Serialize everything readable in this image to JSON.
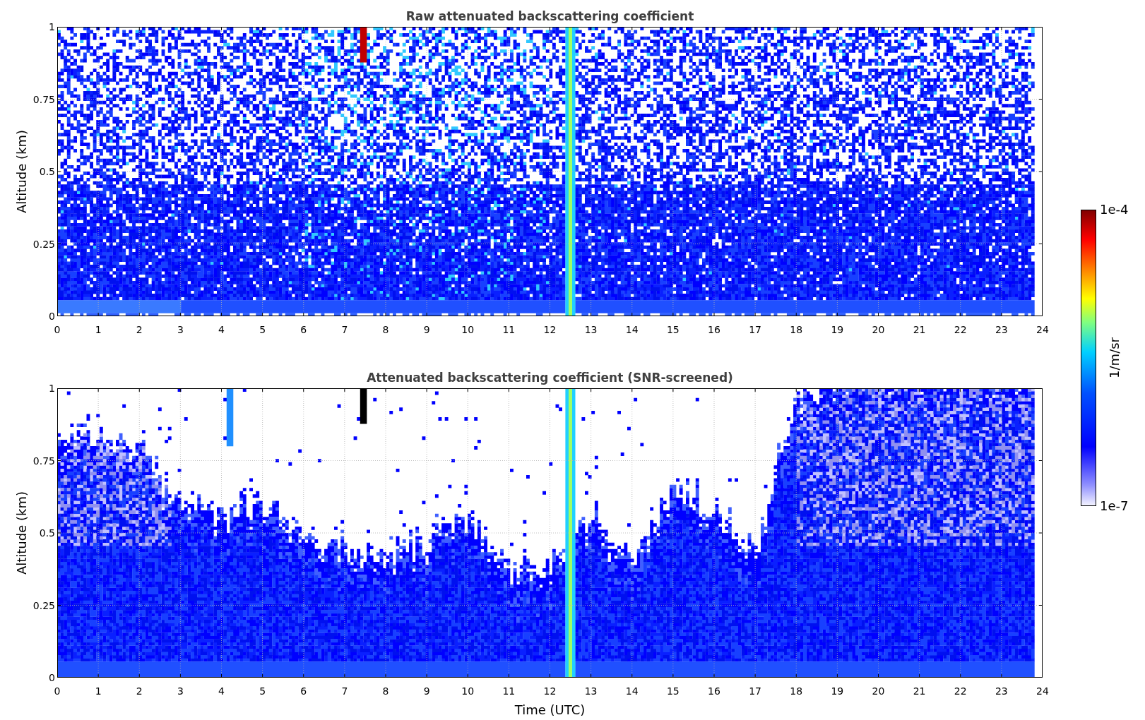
{
  "plots": [
    {
      "kind": "raw",
      "title": "Raw attenuated backscattering coefficient",
      "ylabel": "Altitude (km)",
      "yticks": [
        "1",
        "0.75",
        "0.5",
        "0.25",
        "0"
      ],
      "xticks": [
        "0",
        "1",
        "2",
        "3",
        "4",
        "5",
        "6",
        "7",
        "8",
        "9",
        "10",
        "11",
        "12",
        "13",
        "14",
        "15",
        "16",
        "17",
        "18",
        "19",
        "20",
        "21",
        "22",
        "23",
        "24"
      ]
    },
    {
      "kind": "screened",
      "title": "Attenuated backscattering coefficient (SNR-screened)",
      "ylabel": "Altitude (km)",
      "yticks": [
        "1",
        "0.75",
        "0.5",
        "0.25",
        "0"
      ],
      "xticks": [
        "0",
        "1",
        "2",
        "3",
        "4",
        "5",
        "6",
        "7",
        "8",
        "9",
        "10",
        "11",
        "12",
        "13",
        "14",
        "15",
        "16",
        "17",
        "18",
        "19",
        "20",
        "21",
        "22",
        "23",
        "24"
      ]
    }
  ],
  "xlabel": "Time (UTC)",
  "colorbar": {
    "max": "1e-4",
    "label": "1/m/sr",
    "min": "1e-7"
  }
}
